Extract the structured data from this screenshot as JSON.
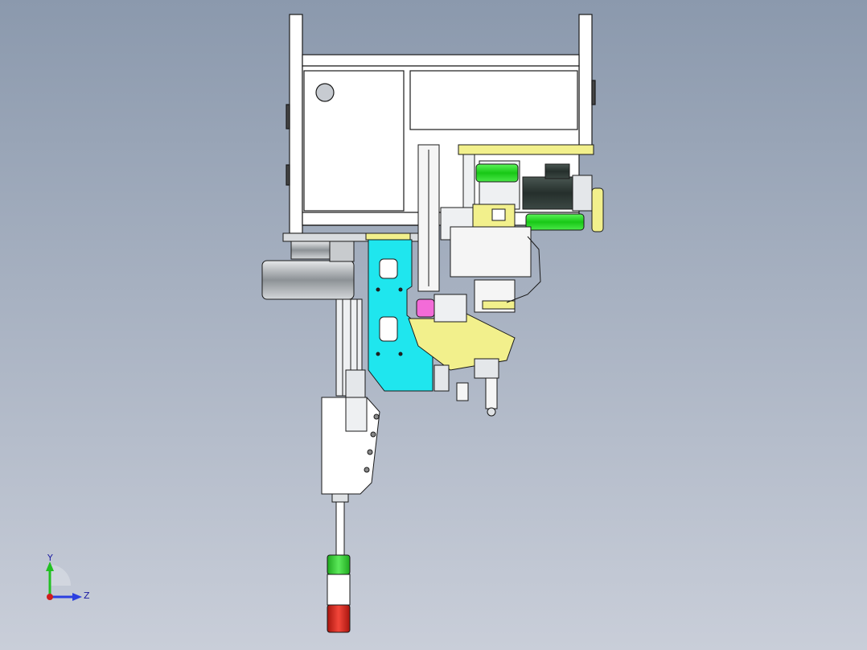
{
  "viewport": {
    "background": {
      "top": "#8b99ad",
      "bottom": "#c9ced9"
    },
    "colors": {
      "frame": "#ffffff",
      "outline": "#1a1a1a",
      "bracket_cyan": "#1fe6ee",
      "part_yellow": "#f2f08c",
      "roller_green": "#22e020",
      "motor_dark": "#2e3a36",
      "pulley_gray": "#a9aeb0",
      "lamp_green": "#2fd12f",
      "lamp_red": "#e12a1e",
      "pink_part": "#f36bd8"
    }
  },
  "triad": {
    "y_label": "Y",
    "z_label": "Z",
    "y_color": "#22c022",
    "z_color": "#2b3fe0",
    "origin_color": "#d01c1c"
  }
}
